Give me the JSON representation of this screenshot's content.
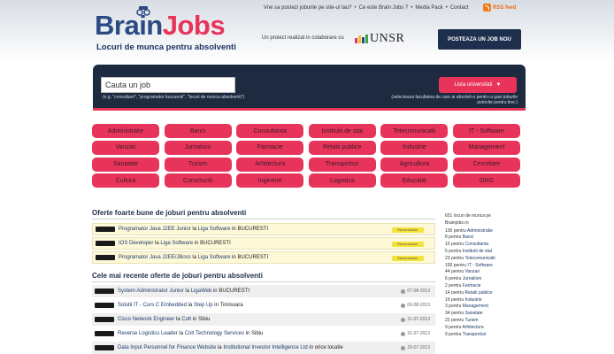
{
  "header": {
    "top_links": [
      "Vrei sa postezi joburile pe site-ul tau?",
      "•",
      "Ce este Brain Jobs ?",
      "•",
      "Media Pack",
      "•",
      "Contact"
    ],
    "rss": "RSS feed",
    "logo_part1": "Brain",
    "logo_part2": "Jobs",
    "tagline": "Locuri de munca pentru absolventi",
    "partner_text": "Un proiect realizat in colaborare cu",
    "partner_logo": "UNSR",
    "post_button": "POSTEAZA UN JOB NOU"
  },
  "search": {
    "placeholder": "Cauta un job",
    "hint": "(e.g. \"consultant\", \"programator bucuresti\", \"locuri de munca absolventi\")",
    "category_button": "Lista universitati",
    "category_hint": "(selecteaza facultatea de care ai absolvit-o pentru a gasi joburile potrivite pentru tine.)"
  },
  "categories": [
    "Administratie",
    "Banci",
    "Consultanta",
    "Institutii de stat",
    "Telecomunicatii",
    "IT - Software",
    "Vanzari",
    "Jurnalism",
    "Farmacie",
    "Relatii publice",
    "Industrie",
    "Management",
    "Sanatate",
    "Turism",
    "Arhitectura",
    "Transporturi",
    "Agricultura",
    "Cercetare",
    "Cultura",
    "Constructii",
    "Inginerie",
    "Logistica",
    "Educatie",
    "ONG"
  ],
  "featured": {
    "heading": "Oferte foarte bune de joburi pentru absolventi",
    "jobs": [
      {
        "title": "Programator Java J2EE Junior",
        "company": "Liga Software",
        "city": "BUCURESTI",
        "badge": "Recomandat"
      },
      {
        "title": "IOS Developer",
        "company": "Liga Software",
        "city": "BUCURESTI",
        "badge": "Recomandat"
      },
      {
        "title": "Programator Java J2EE/JBoss",
        "company": "Liga Software",
        "city": "BUCURESTI",
        "badge": "Recomandat"
      }
    ]
  },
  "recent": {
    "heading": "Cele mai recente oferte de joburi pentru absolventi",
    "jobs": [
      {
        "title": "System Administrator Junior",
        "company": "LigaWeb",
        "city": "BUCURESTI",
        "date": "07-08-2013"
      },
      {
        "title": "Solutii IT - Curs C Embedded",
        "company": "Step Up",
        "city": "Timisoara",
        "date": "06-08-2013"
      },
      {
        "title": "Cisco Network Engineer",
        "company": "Colt",
        "city": "Sibiu",
        "date": "31-07-2013"
      },
      {
        "title": "Reverse Logistics Leader",
        "company": "Colt Technology Services",
        "city": "Sibiu",
        "date": "31-07-2013"
      },
      {
        "title": "Data Input Personnel for Finance Website",
        "company": "Institutional Investor Intelligence Ltd",
        "city": "orice locatie",
        "date": "29-07-2013"
      }
    ]
  },
  "sidebar": {
    "intro": "651 locuri de munca pe Brainjobs.ro",
    "items": [
      {
        "count": "136 pentru",
        "cat": "Administratie"
      },
      {
        "count": "8 pentru",
        "cat": "Banci"
      },
      {
        "count": "10 pentru",
        "cat": "Consultanta"
      },
      {
        "count": "5 pentru",
        "cat": "Institutii de stat"
      },
      {
        "count": "23 pentru",
        "cat": "Telecomunicatii"
      },
      {
        "count": "100 pentru",
        "cat": "IT - Software"
      },
      {
        "count": "44 pentru",
        "cat": "Vanzari"
      },
      {
        "count": "6 pentru",
        "cat": "Jurnalism"
      },
      {
        "count": "2 pentru",
        "cat": "Farmacie"
      },
      {
        "count": "14 pentru",
        "cat": "Relatii publice"
      },
      {
        "count": "19 pentru",
        "cat": "Industrie"
      },
      {
        "count": "3 pentru",
        "cat": "Management"
      },
      {
        "count": "34 pentru",
        "cat": "Sanatate"
      },
      {
        "count": "22 pentru",
        "cat": "Turism"
      },
      {
        "count": "9 pentru",
        "cat": "Arhitectura"
      },
      {
        "count": "9 pentru",
        "cat": "Transporturi"
      }
    ]
  },
  "colors": {
    "accent": "#e8345a",
    "navy": "#1d2a3f",
    "brand_blue": "#2a4a83"
  }
}
